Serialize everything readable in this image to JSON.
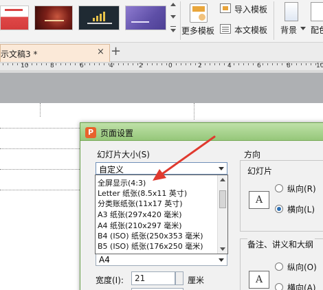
{
  "ribbon": {
    "more_templates": "更多模板",
    "import_template": "导入模板",
    "text_template": "本文模板",
    "background": "背景",
    "color_scheme": "配色"
  },
  "tab": {
    "label": "示文稿3 *",
    "close": "×",
    "new": "+"
  },
  "ruler": {
    "numbers": [
      "10",
      "8",
      "6",
      "4",
      "2",
      "0",
      "2",
      "4",
      "6",
      "8",
      "10"
    ]
  },
  "dialog": {
    "title": "页面设置",
    "logo": "P",
    "slide_size_label": "幻灯片大小(S)",
    "slide_size_selected": "自定义",
    "slide_size_options": [
      "全屏显示(4:3)",
      "Letter 纸张(8.5x11 英寸)",
      "分类账纸张(11x17 英寸)",
      "A3 纸张(297x420 毫米)",
      "A4 纸张(210x297 毫米)",
      "B4 (ISO) 纸张(250x353 毫米)",
      "B5 (ISO) 纸张(176x250 毫米)"
    ],
    "paper_selected": "A4",
    "width_label": "宽度(I):",
    "width_value": "21",
    "width_unit": "厘米",
    "orientation_label": "方向",
    "slides_group": "幻灯片",
    "portrait": "纵向(R)",
    "landscape": "横向(L)",
    "notes_group": "备注、讲义和大纲",
    "notes_portrait": "纵向(O)",
    "notes_landscape": "横向(A)",
    "orient_icon_letter": "A"
  },
  "colors": {
    "annotation_arrow": "#e03a2f",
    "dialog_title": "#a8d48e"
  }
}
